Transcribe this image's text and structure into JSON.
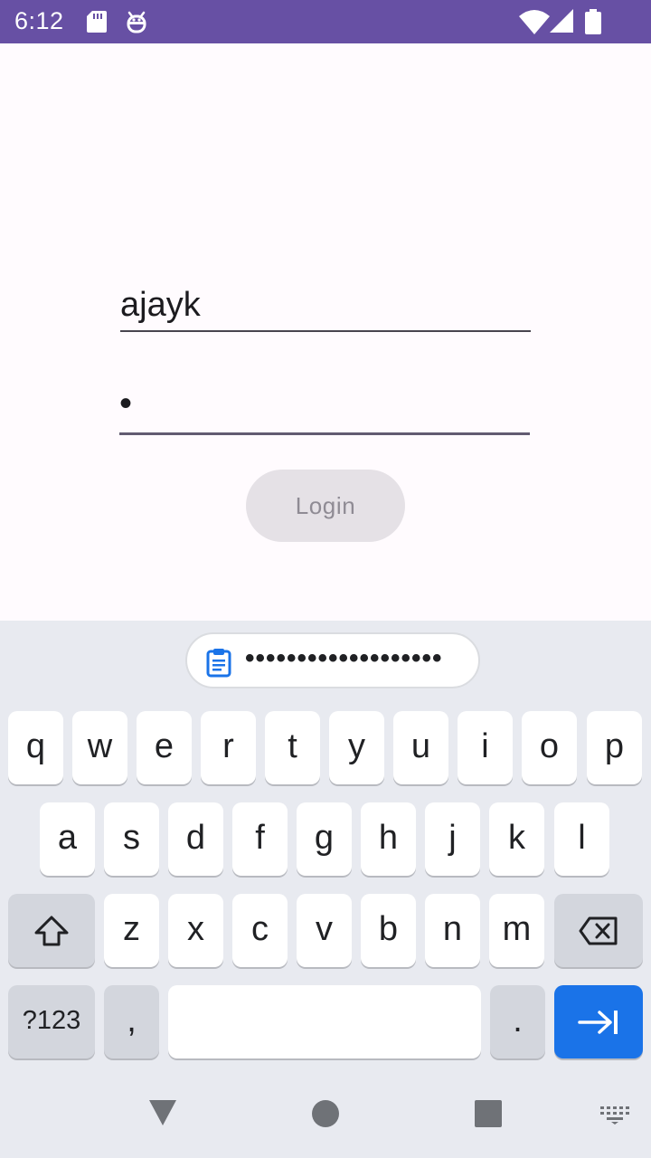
{
  "status_bar": {
    "time": "6:12",
    "icons": [
      "sd-card-icon",
      "debug-icon",
      "wifi-icon",
      "signal-icon",
      "battery-icon"
    ],
    "background": "#6750a4"
  },
  "login_form": {
    "username_value": "ajayk",
    "password_value": "•",
    "login_label": "Login"
  },
  "keyboard": {
    "clipboard_suggestion": "•••••••••••••••••••",
    "row1": [
      "q",
      "w",
      "e",
      "r",
      "t",
      "y",
      "u",
      "i",
      "o",
      "p"
    ],
    "row2": [
      "a",
      "s",
      "d",
      "f",
      "g",
      "h",
      "j",
      "k",
      "l"
    ],
    "row3": [
      "z",
      "x",
      "c",
      "v",
      "b",
      "n",
      "m"
    ],
    "symbols_label": "?123",
    "comma_label": ",",
    "period_label": ".",
    "action_color": "#1a73e8"
  },
  "navigation_bar": {
    "icons": [
      "back-icon",
      "home-icon",
      "recents-icon",
      "keyboard-switch-icon"
    ]
  }
}
